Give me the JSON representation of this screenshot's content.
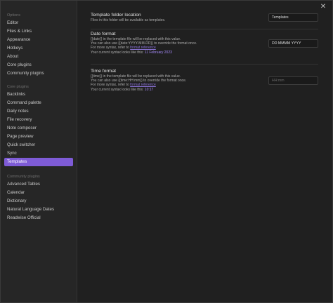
{
  "window": {
    "close_glyph": "✕"
  },
  "sidebar": {
    "options_title": "Options",
    "options": [
      "Editor",
      "Files & Links",
      "Appearance",
      "Hotkeys",
      "About",
      "Core plugins",
      "Community plugins"
    ],
    "core_title": "Core plugins",
    "core": [
      "Backlinks",
      "Command palette",
      "Daily notes",
      "File recovery",
      "Note composer",
      "Page preview",
      "Quick switcher",
      "Sync",
      "Templates"
    ],
    "active_item": "Templates",
    "community_title": "Community plugins",
    "community": [
      "Advanced Tables",
      "Calendar",
      "Dictionary",
      "Natural Language Dates",
      "Readwise Official"
    ]
  },
  "settings": {
    "folder": {
      "name": "Template folder location",
      "desc": "Files in this folder will be available as templates.",
      "value": "Templates"
    },
    "date": {
      "name": "Date format",
      "line1": "{{date}} in the template file will be replaced with this value.",
      "line2": "You can also use {{date:YYYY-MM-DD}} to override the format once.",
      "line3_prefix": "For more syntax, refer to ",
      "line3_link": "format reference",
      "line4_prefix": "Your current syntax looks like this: ",
      "line4_value": "11 February 2023",
      "value": "DD MMMM YYYY"
    },
    "time": {
      "name": "Time format",
      "line1": "{{time}} in the template file will be replaced with this value.",
      "line2": "You can also use {{time:HH:mm}} to override the format once.",
      "line3_prefix": "For more syntax, refer to ",
      "line3_link": "format reference",
      "line4_prefix": "Your current syntax looks like this: ",
      "line4_value": "10:17",
      "value": "",
      "placeholder": "HH:mm"
    }
  },
  "colors": {
    "accent": "#7e5bd6",
    "link": "#8a72d6"
  }
}
